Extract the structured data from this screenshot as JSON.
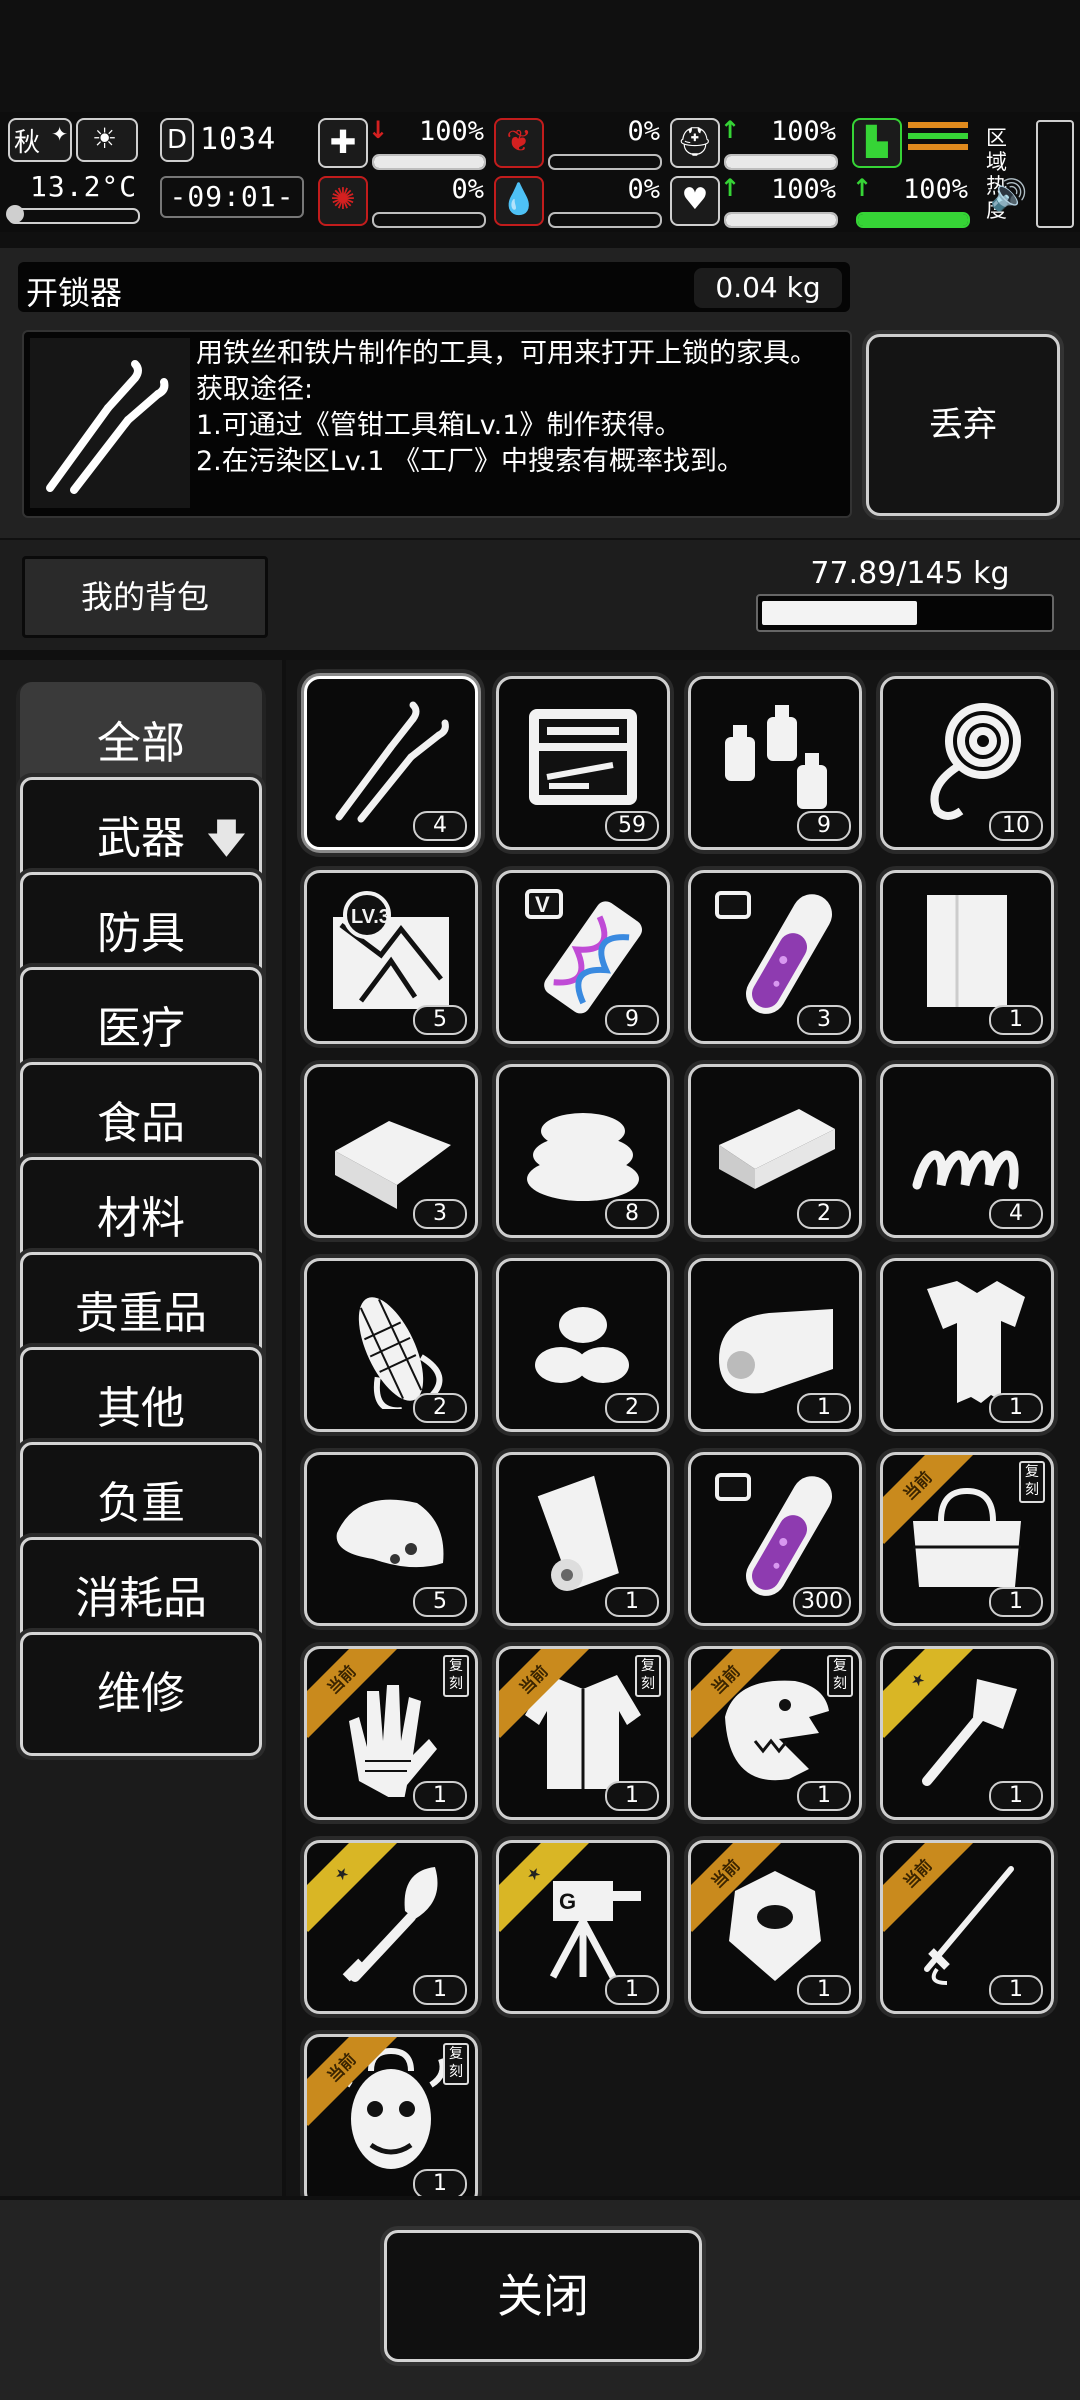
{
  "status": {
    "season": "秋",
    "temperature": "13.2°C",
    "day": "1034",
    "time": "-09:01-",
    "stats": [
      {
        "name": "health",
        "value": "100%",
        "fill": 1.0,
        "trend": "down"
      },
      {
        "name": "hunger",
        "value": "0%",
        "fill": 0.0,
        "trend": "none"
      },
      {
        "name": "armor",
        "value": "100%",
        "fill": 1.0,
        "trend": "up"
      },
      {
        "name": "mental",
        "value": "0%",
        "fill": 0.0,
        "trend": "none"
      },
      {
        "name": "thirst",
        "value": "0%",
        "fill": 0.0,
        "trend": "none"
      },
      {
        "name": "mood",
        "value": "100%",
        "fill": 1.0,
        "trend": "up"
      },
      {
        "name": "stamina",
        "value": "100%",
        "fill": 1.0,
        "trend": "up"
      }
    ],
    "zone_heat_label": "区域\n热度"
  },
  "item": {
    "name": "开锁器",
    "weight": "0.04 kg",
    "description": "用铁丝和铁片制作的工具，可用来打开上锁的家具。\n获取途径:\n1.可通过《管钳工具箱Lv.1》制作获得。\n2.在污染区Lv.1 《工厂》中搜索有概率找到。",
    "discard_label": "丢弃"
  },
  "backpack": {
    "label": "我的背包",
    "capacity_text": "77.89/145 kg",
    "fill_fraction": 0.537
  },
  "categories": [
    {
      "label": "全部",
      "active": true
    },
    {
      "label": "武器",
      "arrow": "🡇"
    },
    {
      "label": "防具"
    },
    {
      "label": "医疗"
    },
    {
      "label": "食品"
    },
    {
      "label": "材料"
    },
    {
      "label": "贵重品"
    },
    {
      "label": "其他"
    },
    {
      "label": "负重"
    },
    {
      "label": "消耗品"
    },
    {
      "label": "维修"
    }
  ],
  "items": [
    {
      "icon": "lockpick-icon",
      "count": "4",
      "selected": true
    },
    {
      "icon": "toolbox-icon",
      "count": "59"
    },
    {
      "icon": "bottles-icon",
      "count": "9"
    },
    {
      "icon": "rope-icon",
      "count": "10"
    },
    {
      "icon": "map-lv3-icon",
      "count": "5",
      "text": "LV.3"
    },
    {
      "icon": "vaccine-v-icon",
      "count": "9",
      "text": "V"
    },
    {
      "icon": "test-tube-icon",
      "count": "3"
    },
    {
      "icon": "cloth-icon",
      "count": "1"
    },
    {
      "icon": "fabric-icon",
      "count": "3"
    },
    {
      "icon": "towel-stack-icon",
      "count": "8"
    },
    {
      "icon": "brick-icon",
      "count": "2"
    },
    {
      "icon": "spring-icon",
      "count": "4"
    },
    {
      "icon": "corn-icon",
      "count": "2"
    },
    {
      "icon": "seeds-icon",
      "count": "2"
    },
    {
      "icon": "blanket-icon",
      "count": "1"
    },
    {
      "icon": "torn-shirt-icon",
      "count": "1"
    },
    {
      "icon": "meat-icon",
      "count": "5"
    },
    {
      "icon": "paper-roll-icon",
      "count": "1"
    },
    {
      "icon": "test-tube-icon",
      "count": "300"
    },
    {
      "icon": "bag-icon",
      "count": "1",
      "ribbon": "当前",
      "ribbon_color": "orange",
      "dup": "复刻"
    },
    {
      "icon": "glove-icon",
      "count": "1",
      "ribbon": "当前",
      "ribbon_color": "orange",
      "dup": "复刻"
    },
    {
      "icon": "coat-icon",
      "count": "1",
      "ribbon": "当前",
      "ribbon_color": "orange",
      "dup": "复刻"
    },
    {
      "icon": "dino-mask-icon",
      "count": "1",
      "ribbon": "当前",
      "ribbon_color": "orange",
      "dup": "复刻"
    },
    {
      "icon": "axe-icon",
      "count": "1",
      "ribbon": "★",
      "ribbon_color": "gold"
    },
    {
      "icon": "shovel-icon",
      "count": "1",
      "ribbon": "★",
      "ribbon_color": "gold"
    },
    {
      "icon": "turret-icon",
      "count": "1",
      "ribbon": "★",
      "ribbon_color": "gold"
    },
    {
      "icon": "armor-plate-icon",
      "count": "1",
      "ribbon": "当前",
      "ribbon_color": "orange"
    },
    {
      "icon": "sword-icon",
      "count": "1",
      "ribbon": "当前",
      "ribbon_color": "orange"
    },
    {
      "icon": "medusa-mask-icon",
      "count": "1",
      "ribbon": "当前",
      "ribbon_color": "orange",
      "dup": "复刻"
    }
  ],
  "footer": {
    "close_label": "关闭"
  },
  "colors": {
    "ribbon_orange": "#c98a1d",
    "ribbon_gold": "#d9b625",
    "stamina_green": "#36d436",
    "alert_red": "#d42020"
  }
}
